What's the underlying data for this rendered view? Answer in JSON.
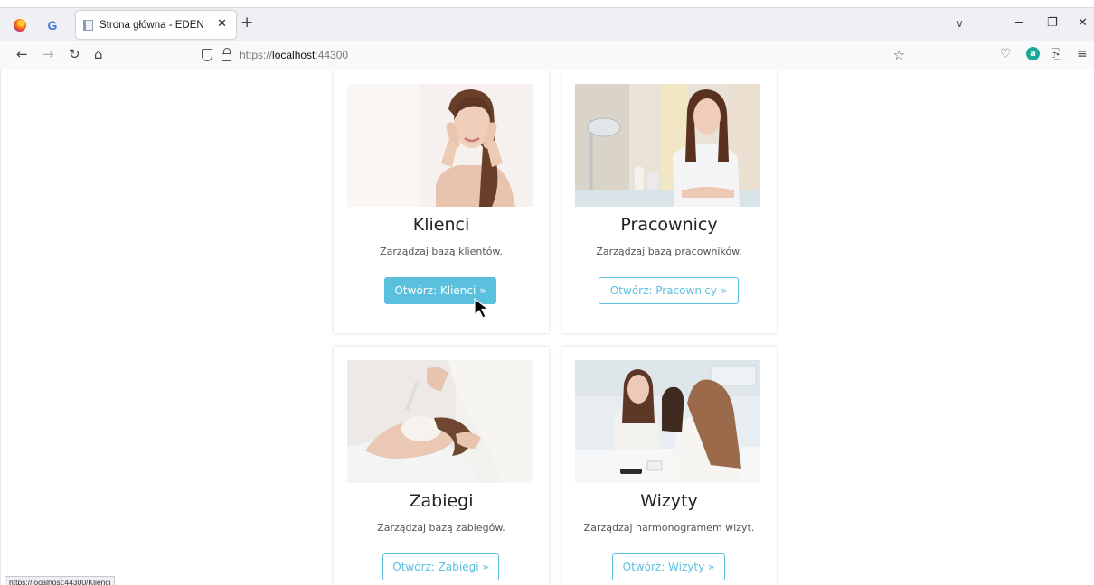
{
  "browser": {
    "tabs": [
      {
        "title": "Strona główna - EDEN"
      }
    ],
    "url_prefix": "https://",
    "url_host": "localhost",
    "url_suffix": ":44300",
    "status_url": "https://localhost:44300/Klienci"
  },
  "cards": [
    {
      "title": "Klienci",
      "description": "Zarządzaj bazą klientów.",
      "button": "Otwórz: Klienci »",
      "button_state": "active",
      "image_icon": "woman-face-care-photo"
    },
    {
      "title": "Pracownicy",
      "description": "Zarządzaj bazą pracowników.",
      "button": "Otwórz: Pracownicy »",
      "button_state": "default",
      "image_icon": "salon-worker-photo"
    },
    {
      "title": "Zabiegi",
      "description": "Zarządzaj bazą zabiegów.",
      "button": "Otwórz: Zabiegi »",
      "button_state": "default",
      "image_icon": "facial-treatment-photo"
    },
    {
      "title": "Wizyty",
      "description": "Zarządzaj harmonogramem wizyt.",
      "button": "Otwórz: Wizyty »",
      "button_state": "default",
      "image_icon": "consultation-photo"
    }
  ],
  "colors": {
    "accent": "#5bc0de",
    "chrome_bg": "#f0f0f4"
  }
}
